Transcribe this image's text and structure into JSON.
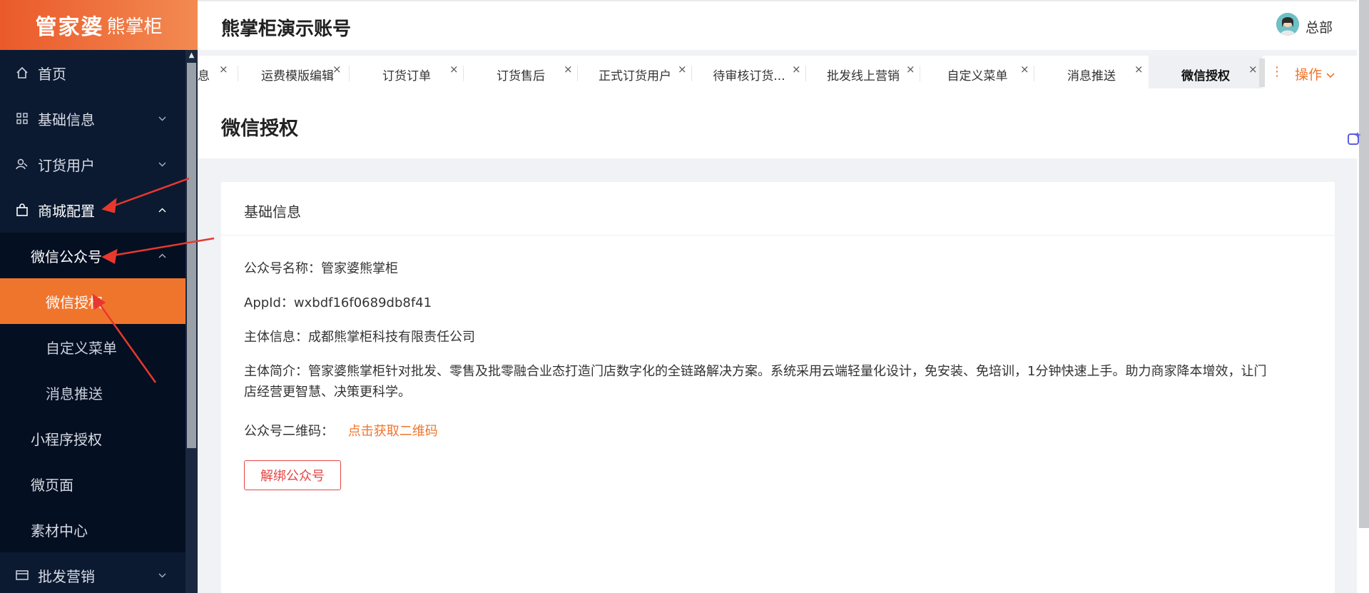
{
  "logo": {
    "brand": "管家婆",
    "sub": "熊掌柜"
  },
  "header": {
    "title": "熊掌柜演示账号",
    "user": "总部"
  },
  "sidebar": {
    "items": [
      {
        "label": "首页",
        "icon": "home-icon"
      },
      {
        "label": "基础信息",
        "icon": "grid-icon"
      },
      {
        "label": "订货用户",
        "icon": "users-icon"
      },
      {
        "label": "商城配置",
        "icon": "bag-icon"
      },
      {
        "label": "微信公众号"
      },
      {
        "label": "微信授权"
      },
      {
        "label": "自定义菜单"
      },
      {
        "label": "消息推送"
      },
      {
        "label": "小程序授权"
      },
      {
        "label": "微页面"
      },
      {
        "label": "素材中心"
      },
      {
        "label": "批发营销",
        "icon": "card-icon"
      }
    ]
  },
  "tabs": [
    {
      "label": "息"
    },
    {
      "label": "运费模版编辑"
    },
    {
      "label": "订货订单"
    },
    {
      "label": "订货售后"
    },
    {
      "label": "正式订货用户"
    },
    {
      "label": "待审核订货..."
    },
    {
      "label": "批发线上营销"
    },
    {
      "label": "自定义菜单"
    },
    {
      "label": "消息推送"
    },
    {
      "label": "微信授权"
    }
  ],
  "tab_ops": "操作",
  "page": {
    "title": "微信授权",
    "card_title": "基础信息",
    "name_label": "公众号名称：",
    "name_value": "管家婆熊掌柜",
    "appid_label": "AppId：",
    "appid_value": "wxbdf16f0689db8f41",
    "subject_label": "主体信息：",
    "subject_value": "成都熊掌柜科技有限责任公司",
    "intro_label": "主体简介：",
    "intro_line1": "管家婆熊掌柜针对批发、零售及批零融合业态打造门店数字化的全链路解决方案。系统采用云端轻量化设计，免安装、免培训，1分钟快速上手。助力商家降本增效，让门",
    "intro_line2": "店经营更智慧、决策更科学。",
    "qr_label": "公众号二维码：",
    "qr_link": "点击获取二维码",
    "unbind_button": "解绑公众号"
  },
  "colors": {
    "accent": "#f0752c",
    "sidebar_bg": "#0b1a31",
    "danger": "#e64545",
    "annotation": "#e8382e"
  }
}
